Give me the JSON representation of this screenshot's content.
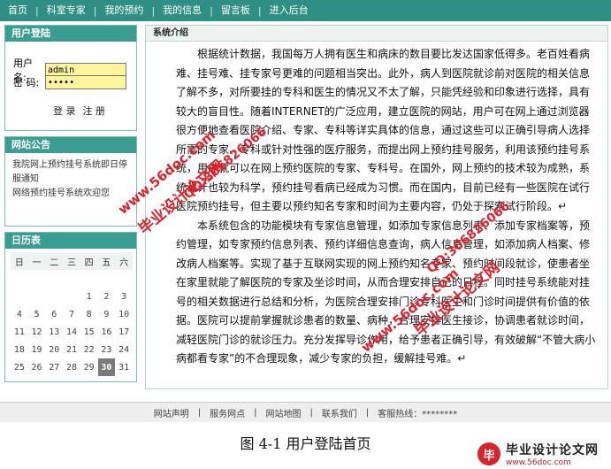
{
  "nav": {
    "items": [
      "首页",
      "科室专家",
      "我的预约",
      "我的信息",
      "留言板",
      "进入后台"
    ],
    "separator": "|"
  },
  "login": {
    "title": "用户登陆",
    "username_label": "用户名:",
    "username_value": "admin",
    "password_label": "密  码:",
    "password_value": "•••••",
    "login_button": "登 录",
    "register_button": "注 册"
  },
  "notice": {
    "title": "网站公告",
    "lines": [
      "我院网上预约挂号系统即日停服通知",
      "网络预约挂号系统欢迎您"
    ]
  },
  "calendar": {
    "title": "日历表",
    "weekdays": [
      "日",
      "一",
      "二",
      "三",
      "四",
      "五",
      "六"
    ],
    "weeks": [
      [
        "",
        "",
        "",
        "",
        "",
        "",
        ""
      ],
      [
        "",
        "",
        "",
        "",
        "1",
        "2",
        "3"
      ],
      [
        "4",
        "5",
        "6",
        "7",
        "8",
        "9",
        "10"
      ],
      [
        "11",
        "12",
        "13",
        "14",
        "15",
        "16",
        "17"
      ],
      [
        "18",
        "19",
        "20",
        "21",
        "22",
        "23",
        "24"
      ],
      [
        "25",
        "26",
        "27",
        "28",
        "29",
        "30",
        "31"
      ]
    ],
    "today": "30"
  },
  "main": {
    "title": "系统介绍",
    "paragraphs": [
      "根据统计数据，我国每万人拥有医生和病床的数目要比发达国家低得多。老百姓看病难、挂号难、挂专家号更难的问题相当突出。此外，病人到医院就诊前对医院的相关信息了解不多，对所要挂的专科和医生的情况又不太了解，只能凭经验和印象进行选择，具有较大的盲目性。随着INTERNET的广泛应用，建立医院的网站，用户可在网上通过浏览器很方便地查看医院介绍、专家、专科等详实具体的信息，通过这些可以正确引导病人选择所需的专家、专科或针对性强的医疗服务，而提出网上预约挂号服务，利用该预约挂号系统，用户就可以在网上预约医院的专家、专科号。在国外，网上预约的技术较为成熟，系统设计也较为科学，预约挂号看病已经成为习惯。而在国内，目前已经有一些医院在试行医院预约挂号，但主要以预约知名专家和时间为主要内容，仍处于探索试行阶段。↵",
      "本系统包含的功能模块有专家信息管理，如添加专家信息列表、添加专家档案等，预约管理，如专家预约信息列表、预约详细信息查询，病人信息管理，如添加病人档案、修改病人档案等。实现了基于互联网实现的网上预约知名专家、预约时间段就诊，使患者坐在家里就能了解医院的专家及坐诊时间，从而合理安排自己的日程。同时挂号系统能对挂号的相关数据进行总结和分析，为医院合理安排门诊专科医生和门诊时间提供有价值的依据。医院可以提前掌握就诊患者的数量、病种，合理安排医生接诊，协调患者就诊时间，减轻医院门诊的就诊压力。充分发挥导诊作用，给予患者正确引导，有效破解“不管大病小病都看专家”的不合理现象，减少专家的负担，缓解挂号难。↵"
    ]
  },
  "footer": {
    "links": [
      "网站声明",
      "|",
      "服务网点",
      "|",
      "网站地图",
      "|",
      "联系我们",
      "|",
      "客服热线：********"
    ]
  },
  "caption": "图 4-1  用户登陆首页",
  "watermarks": {
    "site": "www.56doc.com",
    "qq": "QQ:306826066",
    "brand": "毕业设计论文网"
  },
  "logo": {
    "name": "毕业设计论文网",
    "url": "www.56doc.com",
    "badge": "毕"
  },
  "colors": {
    "nav_bg": "#2f8f85",
    "panel_title_bg": "#3a9d92",
    "watermark": "#e0202a"
  }
}
